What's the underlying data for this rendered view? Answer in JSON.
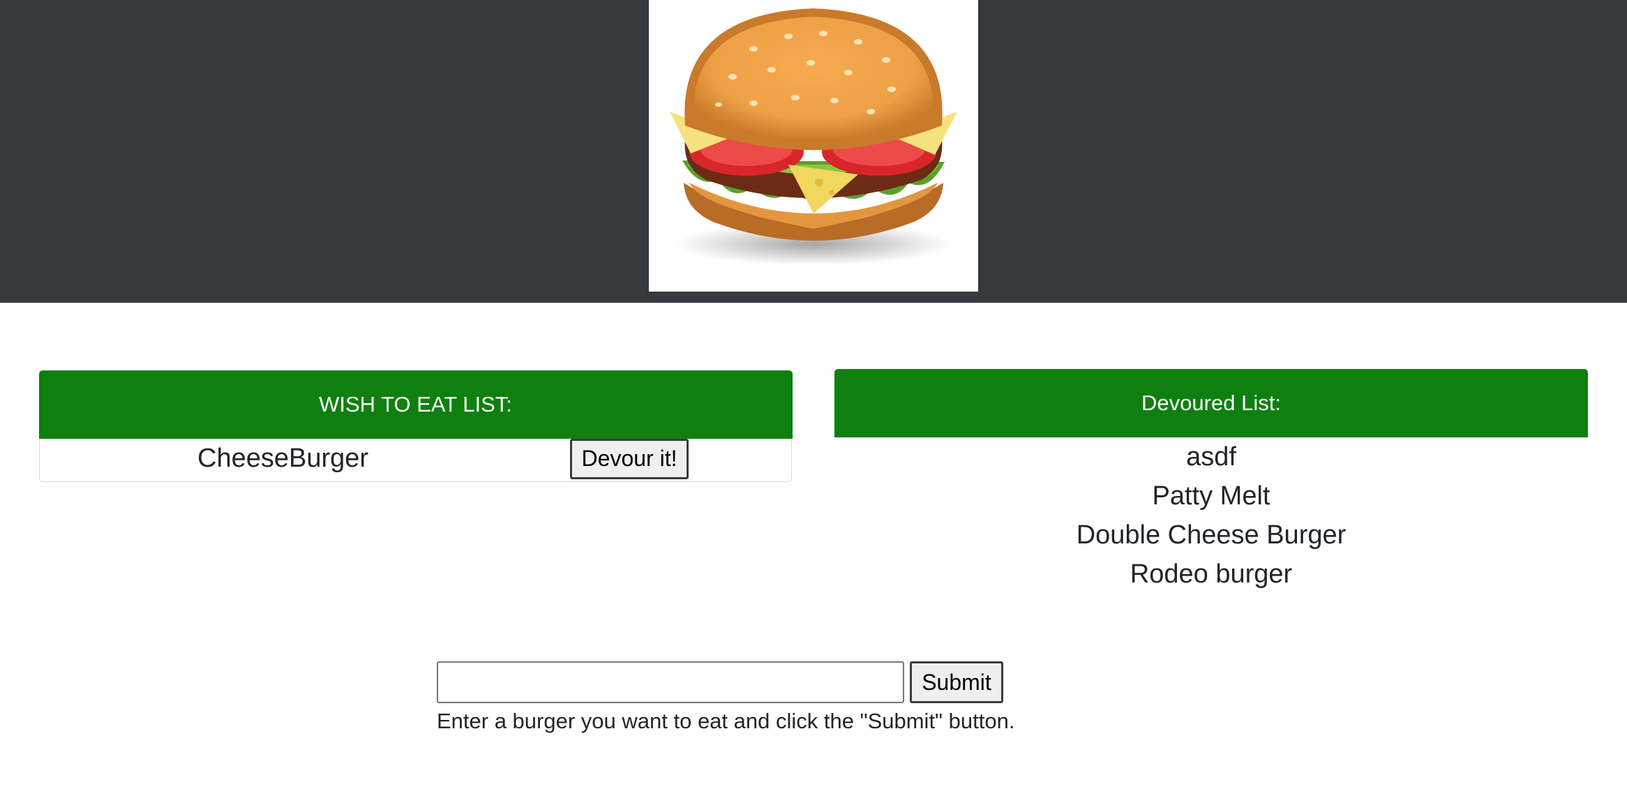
{
  "header": {
    "logo_icon": "hamburger-logo-icon",
    "background_color": "#343a40"
  },
  "wish_list": {
    "title": "WISH TO EAT LIST:",
    "header_color": "#0f8010",
    "items": [
      {
        "name": "CheeseBurger",
        "button_label": "Devour it!"
      }
    ]
  },
  "devoured_list": {
    "title": "Devoured List:",
    "header_color": "#0f8010",
    "items": [
      "asdf",
      "Patty Melt",
      "Double Cheese Burger",
      "Rodeo burger"
    ]
  },
  "form": {
    "input_value": "",
    "input_placeholder": "",
    "submit_label": "Submit",
    "help_text": "Enter a burger you want to eat and click the \"Submit\" button."
  }
}
